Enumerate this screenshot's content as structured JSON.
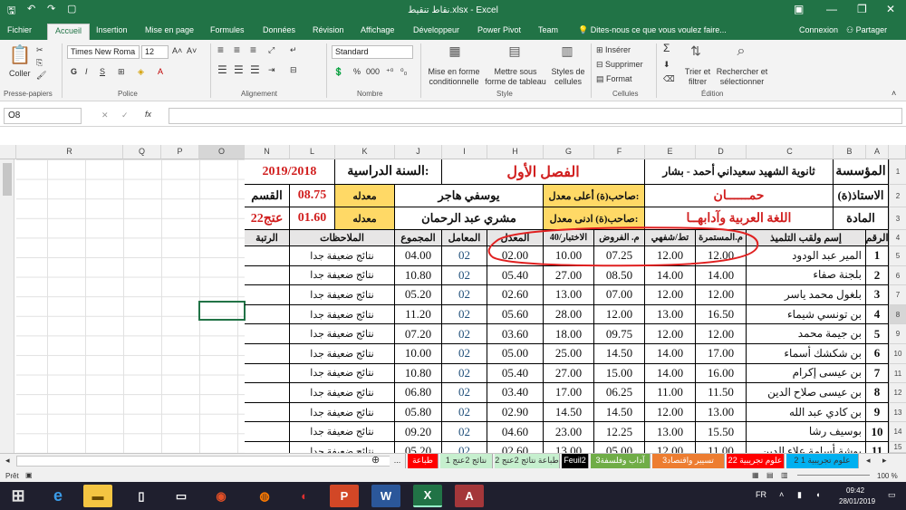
{
  "app": {
    "title": "نقاط تنقيط.xlsx - Excel"
  },
  "ribbon_tabs": [
    "Fichier",
    "Accueil",
    "Insertion",
    "Mise en page",
    "Formules",
    "Données",
    "Révision",
    "Affichage",
    "Développeur",
    "Power Pivot",
    "Team"
  ],
  "tell_me": "Dites-nous ce que vous voulez faire...",
  "account": {
    "connexion": "Connexion",
    "share": "Partager"
  },
  "ribbon": {
    "clipboard": {
      "paste": "Coller",
      "label": "Presse-papiers"
    },
    "font": {
      "name": "Times New Roma",
      "size": "12",
      "label": "Police",
      "bold": "G",
      "italic": "I",
      "underline": "S"
    },
    "alignment": {
      "label": "Alignement"
    },
    "number": {
      "format": "Standard",
      "label": "Nombre"
    },
    "styles": {
      "mfc": "Mise en forme conditionnelle",
      "table": "Mettre sous forme de tableau",
      "cell": "Styles de cellules",
      "label": "Style"
    },
    "cells": {
      "insert": "Insérer",
      "delete": "Supprimer",
      "format": "Format",
      "label": "Cellules"
    },
    "editing": {
      "sort": "Trier et filtrer",
      "find": "Rechercher et sélectionner",
      "label": "Édition"
    }
  },
  "formula_bar": {
    "name_box": "O8",
    "fx": "fx"
  },
  "columns": [
    "A",
    "B",
    "C",
    "D",
    "E",
    "F",
    "G",
    "H",
    "I",
    "J",
    "K",
    "L",
    "N",
    "O",
    "P",
    "Q",
    "R"
  ],
  "header": {
    "school_label": "المؤسسة",
    "school": "ثانوية الشهيد سعيداني أحمد - بشار",
    "semester": "الفصل الأول",
    "year_label": "السنة الدراسية:",
    "year": "2019/2018",
    "teacher_label": "الاستاذ(ة)",
    "teacher": "حمــــــان",
    "highest_label": "صاحب(ة) أعلى معدل:",
    "highest_name": "يوسفي هاجر",
    "highest_avg_label": "معدله",
    "highest_avg": "08.75",
    "class_label": "القسم",
    "subject_label": "المادة",
    "subject": "اللغة العربية وآدابهــا",
    "lowest_label": "صاحب(ة) ادنى معدل:",
    "lowest_name": "مشري عبد الرحمان",
    "lowest_avg_label": "معدله",
    "lowest_avg": "01.60",
    "class": "2عتج2"
  },
  "table_headers": {
    "num": "الرقم",
    "name": "إسم ولقب التلميذ",
    "cont": "م.المستمرة",
    "oral": "تط/شفهي",
    "homework": "م. الفروض",
    "exam": "الاختبار/40",
    "avg": "المعدل",
    "coef": "المعامل",
    "total": "المجموع",
    "remarks": "الملاحظات",
    "rank": "الرتبة"
  },
  "students": [
    {
      "n": "1",
      "name": "المير عبد الودود",
      "d": "12.00",
      "e": "12.00",
      "f": "07.25",
      "g": "10.00",
      "h": "02.00",
      "i": "02",
      "j": "04.00",
      "rem": "نتائج ضعيفة جدا"
    },
    {
      "n": "2",
      "name": "بلجنة صفاء",
      "d": "14.00",
      "e": "14.00",
      "f": "08.50",
      "g": "27.00",
      "h": "05.40",
      "i": "02",
      "j": "10.80",
      "rem": "نتائج ضعيفة جدا"
    },
    {
      "n": "3",
      "name": "بلغول محمد ياسر",
      "d": "12.00",
      "e": "12.00",
      "f": "07.00",
      "g": "13.00",
      "h": "02.60",
      "i": "02",
      "j": "05.20",
      "rem": "نتائج ضعيفة جدا"
    },
    {
      "n": "4",
      "name": "بن تونسي شيماء",
      "d": "16.50",
      "e": "13.00",
      "f": "12.00",
      "g": "28.00",
      "h": "05.60",
      "i": "02",
      "j": "11.20",
      "rem": "نتائج ضعيفة جدا"
    },
    {
      "n": "5",
      "name": "بن جيمة محمد",
      "d": "12.00",
      "e": "12.00",
      "f": "09.75",
      "g": "18.00",
      "h": "03.60",
      "i": "02",
      "j": "07.20",
      "rem": "نتائج ضعيفة جدا"
    },
    {
      "n": "6",
      "name": "بن شكشك أسماء",
      "d": "17.00",
      "e": "14.00",
      "f": "14.50",
      "g": "25.00",
      "h": "05.00",
      "i": "02",
      "j": "10.00",
      "rem": "نتائج ضعيفة جدا"
    },
    {
      "n": "7",
      "name": "بن عيسى إكرام",
      "d": "16.00",
      "e": "14.00",
      "f": "15.00",
      "g": "27.00",
      "h": "05.40",
      "i": "02",
      "j": "10.80",
      "rem": "نتائج ضعيفة جدا"
    },
    {
      "n": "8",
      "name": "بن عيسى صلاح الدين",
      "d": "11.50",
      "e": "11.00",
      "f": "06.25",
      "g": "17.00",
      "h": "03.40",
      "i": "02",
      "j": "06.80",
      "rem": "نتائج ضعيفة جدا"
    },
    {
      "n": "9",
      "name": "بن كادي عبد الله",
      "d": "13.00",
      "e": "12.00",
      "f": "14.50",
      "g": "14.50",
      "h": "02.90",
      "i": "02",
      "j": "05.80",
      "rem": "نتائج ضعيفة جدا"
    },
    {
      "n": "10",
      "name": "بوسيف رشا",
      "d": "15.50",
      "e": "13.00",
      "f": "12.25",
      "g": "23.00",
      "h": "04.60",
      "i": "02",
      "j": "09.20",
      "rem": "نتائج ضعيفة جدا"
    },
    {
      "n": "11",
      "name": "بوشة أسامة علاء الدين",
      "d": "11.00",
      "e": "12.00",
      "f": "05.00",
      "g": "13.00",
      "h": "02.60",
      "i": "02",
      "j": "05.20",
      "rem": "نتائج ضعيفة جدا"
    }
  ],
  "row_numbers": [
    "1",
    "2",
    "3",
    "4",
    "5",
    "6",
    "7",
    "8",
    "9",
    "10",
    "11",
    "12",
    "13",
    "14",
    "15"
  ],
  "sheet_tabs": [
    {
      "label": "...",
      "color": "#f0f0f0",
      "text": "#333"
    },
    {
      "label": "طباعة",
      "color": "#ff0000",
      "text": "#fff"
    },
    {
      "label": "1 نتائج 2عتج",
      "color": "#c6efce",
      "text": "#333"
    },
    {
      "label": "طباعة نتائج 2عتج 2",
      "color": "#c6efce",
      "text": "#333"
    },
    {
      "label": "Feuil2",
      "color": "#000000",
      "text": "#fff"
    },
    {
      "label": "3آداب وفلسفة",
      "color": "#70ad47",
      "text": "#fff"
    },
    {
      "label": "3تسيير واقتصاد",
      "color": "#ed7d31",
      "text": "#fff"
    },
    {
      "label": "2علوم تجريبية 2",
      "color": "#ff0000",
      "text": "#fff"
    },
    {
      "label": "2 علوم تجريبية 1",
      "color": "#00b0f0",
      "text": "#333"
    }
  ],
  "status": {
    "ready": "Prêt",
    "zoom": "100 %"
  },
  "taskbar": {
    "lang": "FR",
    "time": "09:42",
    "date": "28/01/2019"
  }
}
